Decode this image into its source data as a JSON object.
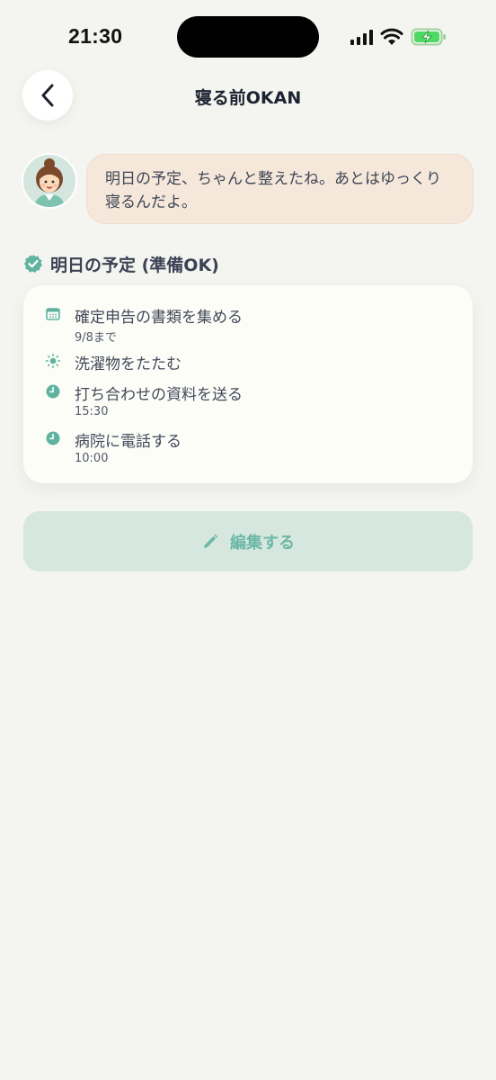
{
  "status_bar": {
    "time": "21:30"
  },
  "header": {
    "title": "寝る前OKAN",
    "back_icon": "chevron-left-icon"
  },
  "message": {
    "avatar_icon": "okan-avatar",
    "text": "明日の予定、ちゃんと整えたね。あとはゆっくり寝るんだよ。"
  },
  "section": {
    "icon": "verified-badge-icon",
    "title": "明日の予定 (準備OK)"
  },
  "tasks": [
    {
      "icon": "calendar-icon",
      "label": "確定申告の書類を集める",
      "sub": "9/8まで"
    },
    {
      "icon": "sun-icon",
      "label": "洗濯物をたたむ",
      "sub": ""
    },
    {
      "icon": "clock-icon",
      "label": "打ち合わせの資料を送る",
      "sub": "15:30"
    },
    {
      "icon": "clock-icon",
      "label": "病院に電話する",
      "sub": "10:00"
    }
  ],
  "edit_button": {
    "icon": "pencil-icon",
    "label": "編集する"
  },
  "colors": {
    "background": "#f4f4f0",
    "accent": "#5fb3a0",
    "bubble": "#f5e8db",
    "button_bg": "#d6e7e0"
  }
}
